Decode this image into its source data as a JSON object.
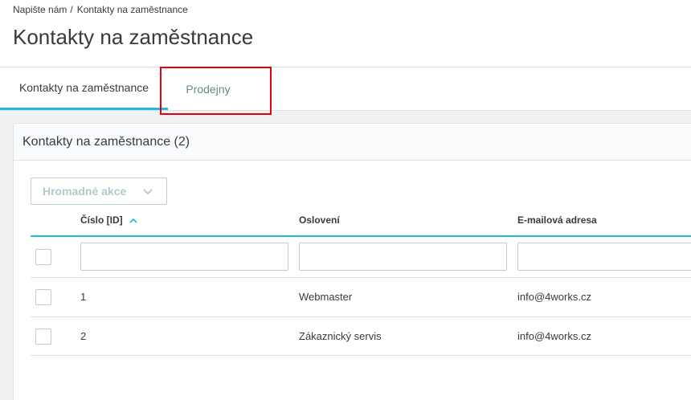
{
  "breadcrumb": {
    "parent": "Napište nám",
    "separator": "/",
    "current": "Kontakty na zaměstnance"
  },
  "page_title": "Kontakty na zaměstnance",
  "tabs": [
    {
      "label": "Kontakty na zaměstnance",
      "active": true
    },
    {
      "label": "Prodejny",
      "active": false
    }
  ],
  "card": {
    "title": "Kontakty na zaměstnance (2)",
    "bulk_actions_label": "Hromadné akce",
    "columns": [
      "Číslo [ID]",
      "Oslovení",
      "E-mailová adresa"
    ],
    "sort_icon": "chevron-up-icon",
    "rows": [
      {
        "id": "1",
        "name": "Webmaster",
        "email": "info@4works.cz"
      },
      {
        "id": "2",
        "name": "Zákaznický servis",
        "email": "info@4works.cz"
      }
    ]
  },
  "colors": {
    "accent": "#25b9d7",
    "highlight": "#e3000f",
    "text": "#363a41",
    "muted": "#6c868e"
  }
}
